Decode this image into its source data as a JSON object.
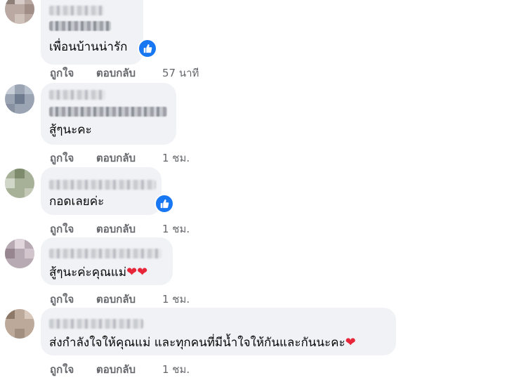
{
  "colors": {
    "bubble": "#f0f2f5",
    "meta_text": "#65676b",
    "like_blue": "#1877f2",
    "heart_red": "#e8263a"
  },
  "comments": [
    {
      "text": "เพื่อนบ้านน่ารัก",
      "hearts": "",
      "like_label": "ถูกใจ",
      "reply_label": "ตอบกลับ",
      "time": "57 นาที",
      "reacted": "thumbs-up-icon"
    },
    {
      "text": "สู้ๆนะคะ",
      "hearts": "",
      "like_label": "ถูกใจ",
      "reply_label": "ตอบกลับ",
      "time": "1 ชม.",
      "reacted": ""
    },
    {
      "text": "กอดเลยค่ะ",
      "hearts": "",
      "like_label": "ถูกใจ",
      "reply_label": "ตอบกลับ",
      "time": "1 ชม.",
      "reacted": "thumbs-up-icon"
    },
    {
      "text": "สู้ๆนะค่ะคุณแม่",
      "hearts": "❤❤",
      "like_label": "ถูกใจ",
      "reply_label": "ตอบกลับ",
      "time": "1 ชม.",
      "reacted": ""
    },
    {
      "text": "ส่งกำลังใจให้คุณแม่ และทุกคนที่มีน้ำใจให้กันและกันนะคะ",
      "hearts": "❤",
      "like_label": "ถูกใจ",
      "reply_label": "ตอบกลับ",
      "time": "1 ชม.",
      "reacted": ""
    }
  ]
}
